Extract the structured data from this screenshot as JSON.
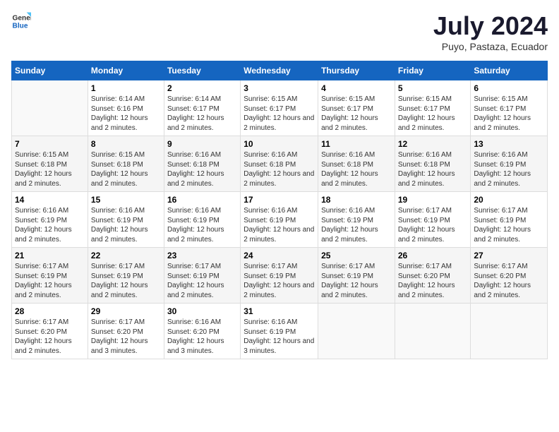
{
  "header": {
    "logo_general": "General",
    "logo_blue": "Blue",
    "title": "July 2024",
    "subtitle": "Puyo, Pastaza, Ecuador"
  },
  "columns": [
    "Sunday",
    "Monday",
    "Tuesday",
    "Wednesday",
    "Thursday",
    "Friday",
    "Saturday"
  ],
  "weeks": [
    [
      {
        "day": "",
        "sunrise": "",
        "sunset": "",
        "daylight": ""
      },
      {
        "day": "1",
        "sunrise": "Sunrise: 6:14 AM",
        "sunset": "Sunset: 6:16 PM",
        "daylight": "Daylight: 12 hours and 2 minutes."
      },
      {
        "day": "2",
        "sunrise": "Sunrise: 6:14 AM",
        "sunset": "Sunset: 6:17 PM",
        "daylight": "Daylight: 12 hours and 2 minutes."
      },
      {
        "day": "3",
        "sunrise": "Sunrise: 6:15 AM",
        "sunset": "Sunset: 6:17 PM",
        "daylight": "Daylight: 12 hours and 2 minutes."
      },
      {
        "day": "4",
        "sunrise": "Sunrise: 6:15 AM",
        "sunset": "Sunset: 6:17 PM",
        "daylight": "Daylight: 12 hours and 2 minutes."
      },
      {
        "day": "5",
        "sunrise": "Sunrise: 6:15 AM",
        "sunset": "Sunset: 6:17 PM",
        "daylight": "Daylight: 12 hours and 2 minutes."
      },
      {
        "day": "6",
        "sunrise": "Sunrise: 6:15 AM",
        "sunset": "Sunset: 6:17 PM",
        "daylight": "Daylight: 12 hours and 2 minutes."
      }
    ],
    [
      {
        "day": "7",
        "sunrise": "Sunrise: 6:15 AM",
        "sunset": "Sunset: 6:18 PM",
        "daylight": "Daylight: 12 hours and 2 minutes."
      },
      {
        "day": "8",
        "sunrise": "Sunrise: 6:15 AM",
        "sunset": "Sunset: 6:18 PM",
        "daylight": "Daylight: 12 hours and 2 minutes."
      },
      {
        "day": "9",
        "sunrise": "Sunrise: 6:16 AM",
        "sunset": "Sunset: 6:18 PM",
        "daylight": "Daylight: 12 hours and 2 minutes."
      },
      {
        "day": "10",
        "sunrise": "Sunrise: 6:16 AM",
        "sunset": "Sunset: 6:18 PM",
        "daylight": "Daylight: 12 hours and 2 minutes."
      },
      {
        "day": "11",
        "sunrise": "Sunrise: 6:16 AM",
        "sunset": "Sunset: 6:18 PM",
        "daylight": "Daylight: 12 hours and 2 minutes."
      },
      {
        "day": "12",
        "sunrise": "Sunrise: 6:16 AM",
        "sunset": "Sunset: 6:18 PM",
        "daylight": "Daylight: 12 hours and 2 minutes."
      },
      {
        "day": "13",
        "sunrise": "Sunrise: 6:16 AM",
        "sunset": "Sunset: 6:19 PM",
        "daylight": "Daylight: 12 hours and 2 minutes."
      }
    ],
    [
      {
        "day": "14",
        "sunrise": "Sunrise: 6:16 AM",
        "sunset": "Sunset: 6:19 PM",
        "daylight": "Daylight: 12 hours and 2 minutes."
      },
      {
        "day": "15",
        "sunrise": "Sunrise: 6:16 AM",
        "sunset": "Sunset: 6:19 PM",
        "daylight": "Daylight: 12 hours and 2 minutes."
      },
      {
        "day": "16",
        "sunrise": "Sunrise: 6:16 AM",
        "sunset": "Sunset: 6:19 PM",
        "daylight": "Daylight: 12 hours and 2 minutes."
      },
      {
        "day": "17",
        "sunrise": "Sunrise: 6:16 AM",
        "sunset": "Sunset: 6:19 PM",
        "daylight": "Daylight: 12 hours and 2 minutes."
      },
      {
        "day": "18",
        "sunrise": "Sunrise: 6:16 AM",
        "sunset": "Sunset: 6:19 PM",
        "daylight": "Daylight: 12 hours and 2 minutes."
      },
      {
        "day": "19",
        "sunrise": "Sunrise: 6:17 AM",
        "sunset": "Sunset: 6:19 PM",
        "daylight": "Daylight: 12 hours and 2 minutes."
      },
      {
        "day": "20",
        "sunrise": "Sunrise: 6:17 AM",
        "sunset": "Sunset: 6:19 PM",
        "daylight": "Daylight: 12 hours and 2 minutes."
      }
    ],
    [
      {
        "day": "21",
        "sunrise": "Sunrise: 6:17 AM",
        "sunset": "Sunset: 6:19 PM",
        "daylight": "Daylight: 12 hours and 2 minutes."
      },
      {
        "day": "22",
        "sunrise": "Sunrise: 6:17 AM",
        "sunset": "Sunset: 6:19 PM",
        "daylight": "Daylight: 12 hours and 2 minutes."
      },
      {
        "day": "23",
        "sunrise": "Sunrise: 6:17 AM",
        "sunset": "Sunset: 6:19 PM",
        "daylight": "Daylight: 12 hours and 2 minutes."
      },
      {
        "day": "24",
        "sunrise": "Sunrise: 6:17 AM",
        "sunset": "Sunset: 6:19 PM",
        "daylight": "Daylight: 12 hours and 2 minutes."
      },
      {
        "day": "25",
        "sunrise": "Sunrise: 6:17 AM",
        "sunset": "Sunset: 6:19 PM",
        "daylight": "Daylight: 12 hours and 2 minutes."
      },
      {
        "day": "26",
        "sunrise": "Sunrise: 6:17 AM",
        "sunset": "Sunset: 6:20 PM",
        "daylight": "Daylight: 12 hours and 2 minutes."
      },
      {
        "day": "27",
        "sunrise": "Sunrise: 6:17 AM",
        "sunset": "Sunset: 6:20 PM",
        "daylight": "Daylight: 12 hours and 2 minutes."
      }
    ],
    [
      {
        "day": "28",
        "sunrise": "Sunrise: 6:17 AM",
        "sunset": "Sunset: 6:20 PM",
        "daylight": "Daylight: 12 hours and 2 minutes."
      },
      {
        "day": "29",
        "sunrise": "Sunrise: 6:17 AM",
        "sunset": "Sunset: 6:20 PM",
        "daylight": "Daylight: 12 hours and 3 minutes."
      },
      {
        "day": "30",
        "sunrise": "Sunrise: 6:16 AM",
        "sunset": "Sunset: 6:20 PM",
        "daylight": "Daylight: 12 hours and 3 minutes."
      },
      {
        "day": "31",
        "sunrise": "Sunrise: 6:16 AM",
        "sunset": "Sunset: 6:19 PM",
        "daylight": "Daylight: 12 hours and 3 minutes."
      },
      {
        "day": "",
        "sunrise": "",
        "sunset": "",
        "daylight": ""
      },
      {
        "day": "",
        "sunrise": "",
        "sunset": "",
        "daylight": ""
      },
      {
        "day": "",
        "sunrise": "",
        "sunset": "",
        "daylight": ""
      }
    ]
  ]
}
